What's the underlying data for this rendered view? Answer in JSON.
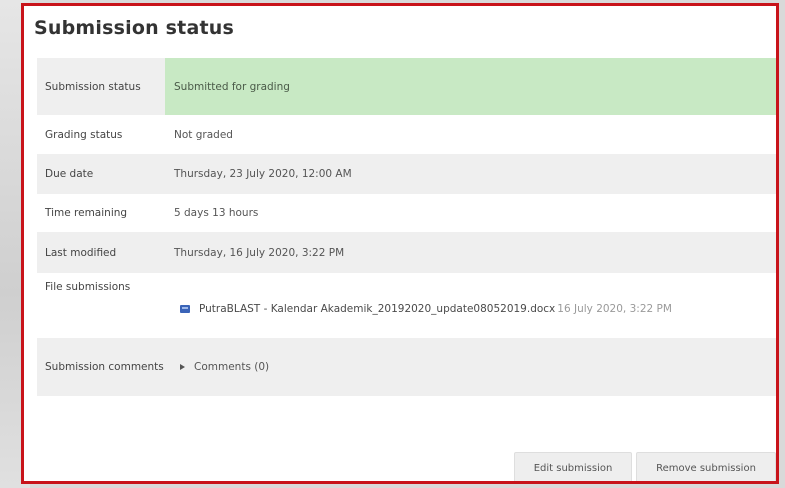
{
  "title": "Submission status",
  "rows": [
    {
      "label": "Submission status",
      "value": "Submitted for grading"
    },
    {
      "label": "Grading status",
      "value": "Not graded"
    },
    {
      "label": "Due date",
      "value": "Thursday, 23 July 2020, 12:00 AM"
    },
    {
      "label": "Time remaining",
      "value": "5 days 13 hours"
    },
    {
      "label": "Last modified",
      "value": "Thursday, 16 July 2020, 3:22 PM"
    },
    {
      "label": "File submissions",
      "file": {
        "name": "PutraBLAST - Kalendar Akademik_20192020_update08052019.docx",
        "date": "16 July 2020, 3:22 PM",
        "icon": "document-icon"
      }
    },
    {
      "label": "Submission comments",
      "toggle": "Comments (0)"
    }
  ],
  "buttons": {
    "edit": "Edit submission",
    "remove": "Remove submission"
  },
  "colors": {
    "frame": "#c8131a",
    "submitted_bg": "#c8e9c4",
    "row_alt": "#efefef"
  }
}
